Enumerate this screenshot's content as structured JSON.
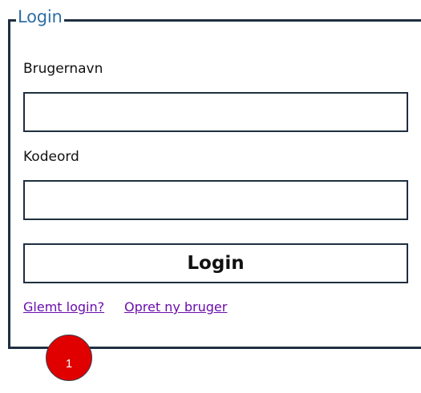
{
  "login_form": {
    "legend": "Login",
    "username_label": "Brugernavn",
    "username_value": "",
    "password_label": "Kodeord",
    "password_value": "",
    "login_button_label": "Login",
    "forgot_link": "Glemt login?",
    "register_link": "Opret ny bruger"
  },
  "annotation": {
    "marker_number": "1",
    "marker_color": "#e00000"
  },
  "colors": {
    "legend": "#2f6fa3",
    "border": "#1f2f40",
    "link": "#6a0dad"
  }
}
